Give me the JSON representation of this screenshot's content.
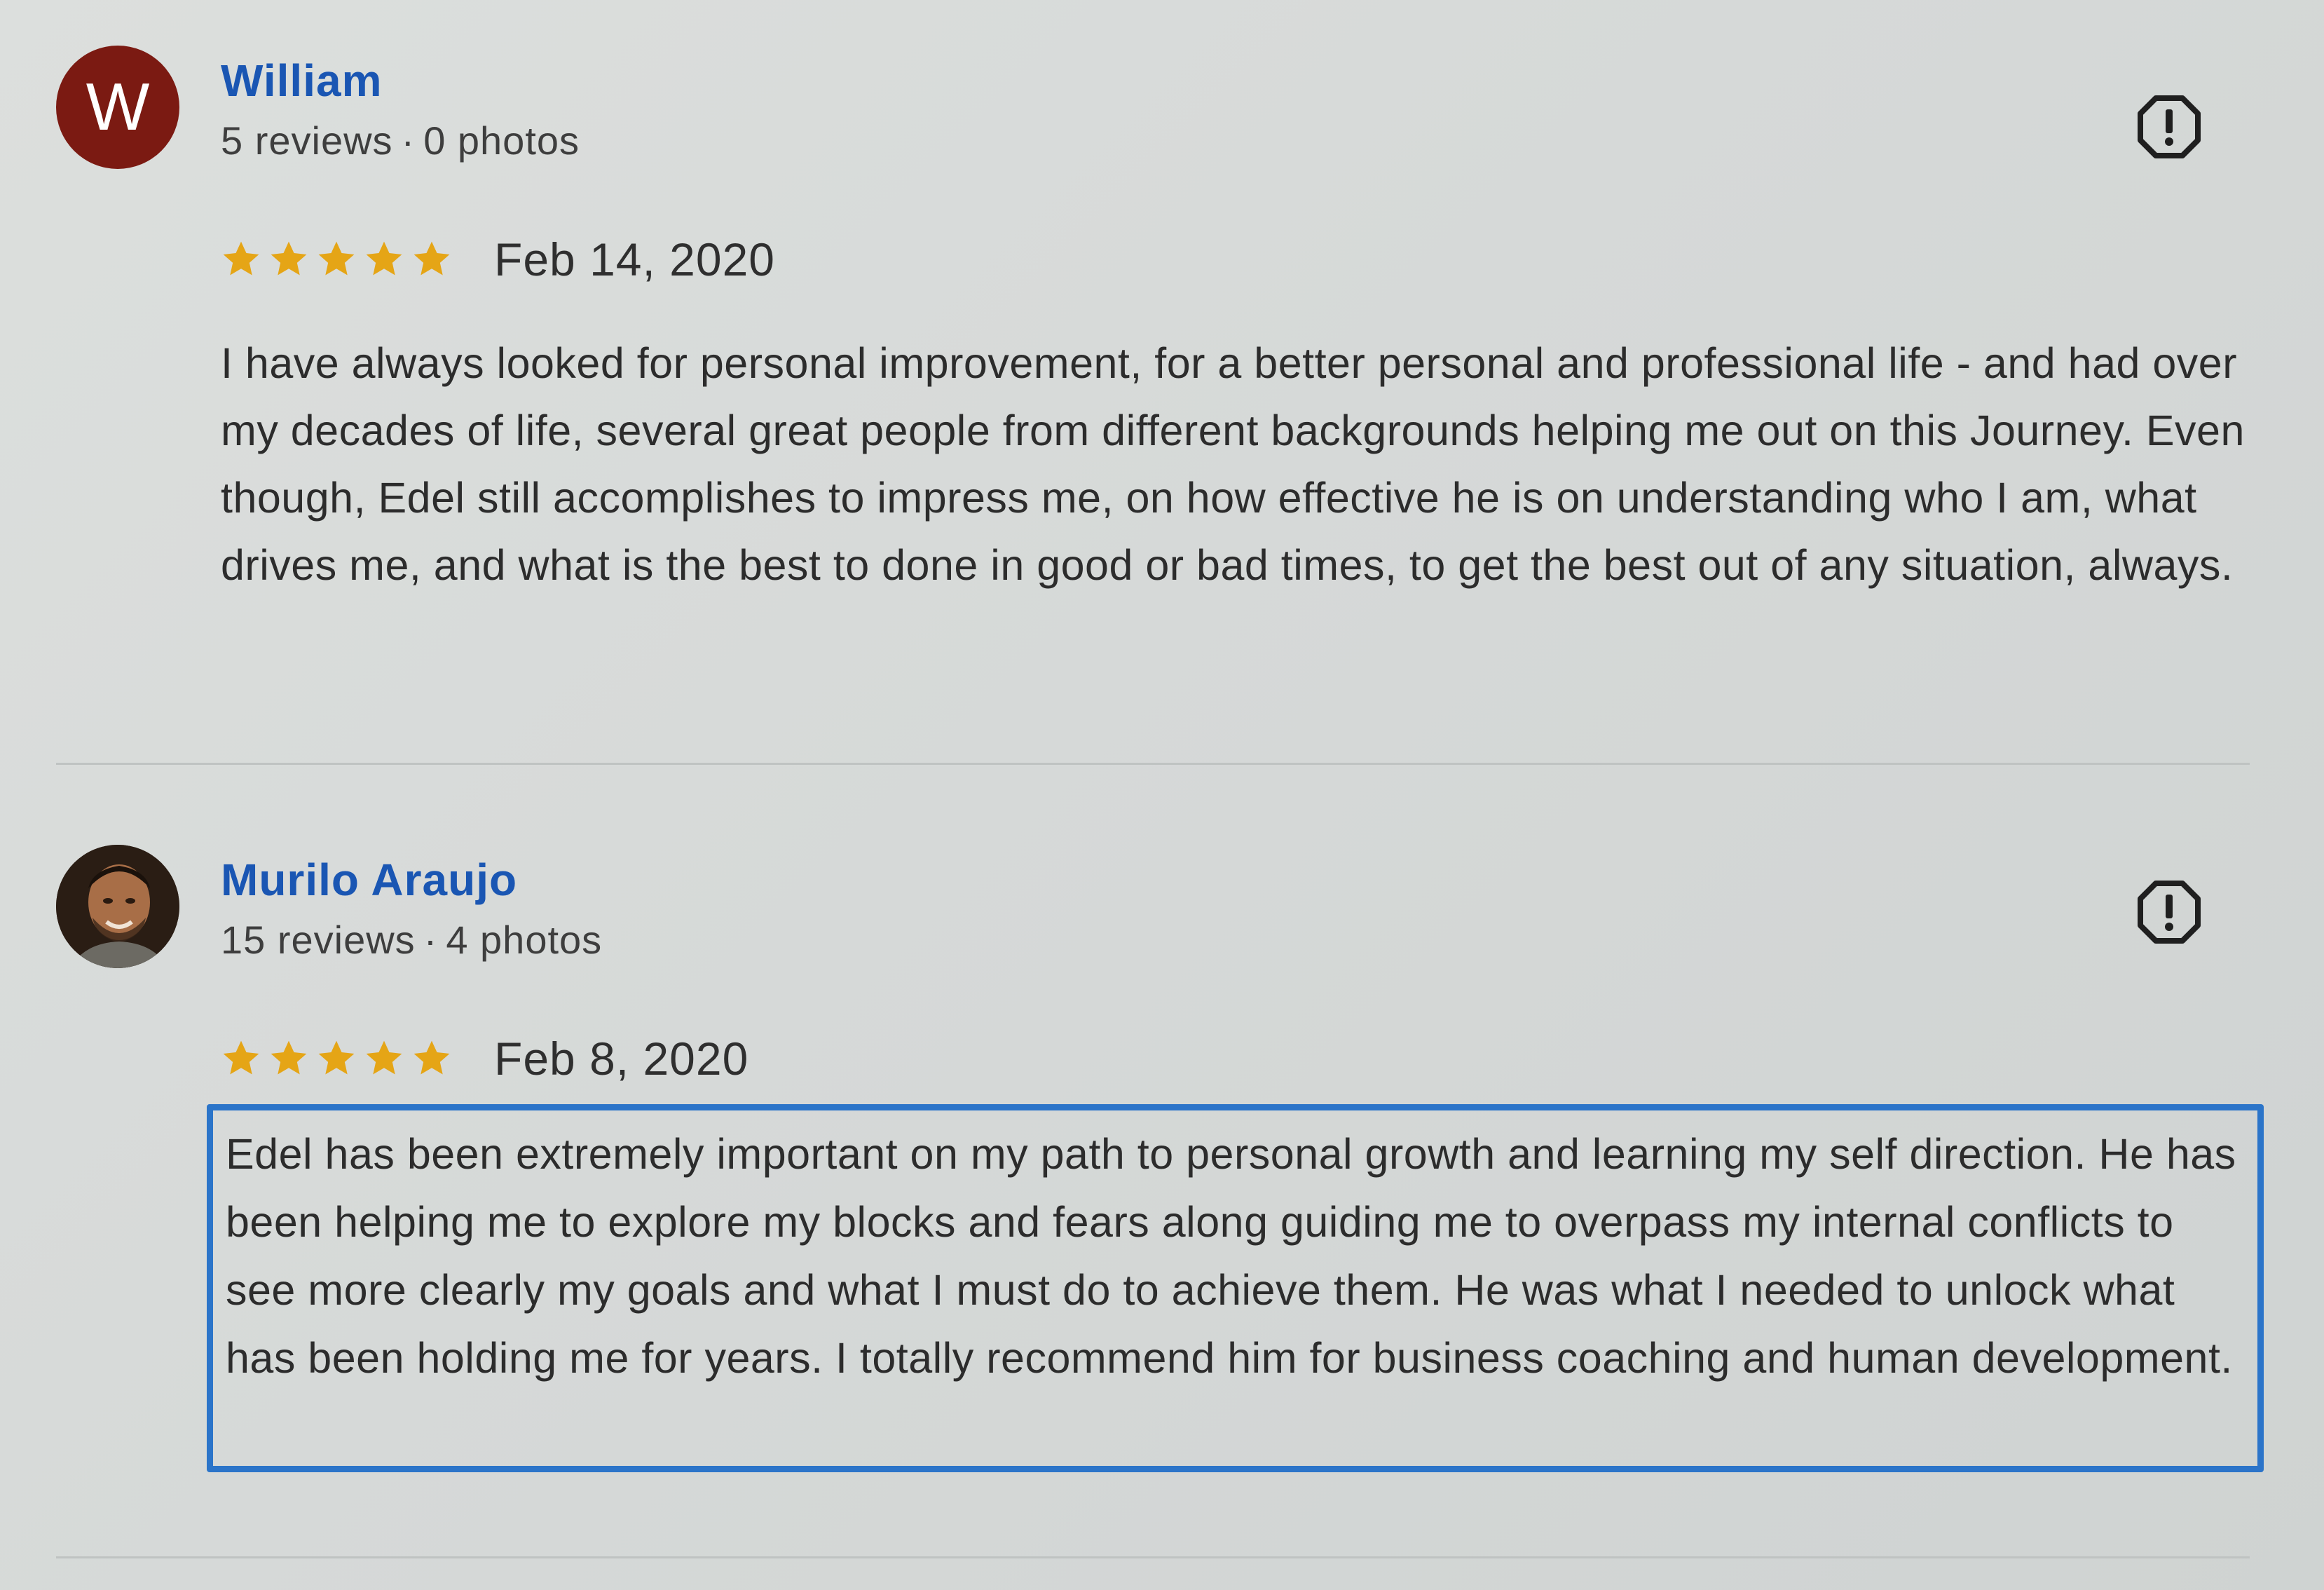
{
  "reviews": [
    {
      "avatar_initial": "W",
      "avatar_color": "#7b1a12",
      "name": "William",
      "reviews_count": "5 reviews",
      "separator": "·",
      "photos_count": "0 photos",
      "rating": 5,
      "date": "Feb 14, 2020",
      "text": "I have always looked for personal improvement, for a better personal and professional life - and had over my decades of life, several great people from different backgrounds helping me out on this Journey. Even though, Edel still accomplishes to impress me, on how effective he is on understanding who I am, what drives me, and what is the best to done in good or bad times, to get the best out of any situation, always.",
      "report_icon": "report-flag-icon",
      "selected": false
    },
    {
      "avatar_initial": "",
      "avatar_color": "#5b3a24",
      "name": "Murilo Araujo",
      "reviews_count": "15 reviews",
      "separator": "·",
      "photos_count": "4 photos",
      "rating": 5,
      "date": "Feb 8, 2020",
      "text": "Edel has been extremely important on my path to personal growth and learning my self direction. He has been helping me to explore my blocks and fears along guiding me to overpass my internal conflicts to see more clearly my goals and what I must do to achieve them. He was what I needed to unlock what has been holding me for years. I totally recommend him for business coaching and human development.",
      "report_icon": "report-flag-icon",
      "selected": true
    }
  ],
  "colors": {
    "name_link": "#1a56b3",
    "star": "#e5a516",
    "selection_border": "#2b74c9",
    "divider": "#bfc3c2"
  }
}
